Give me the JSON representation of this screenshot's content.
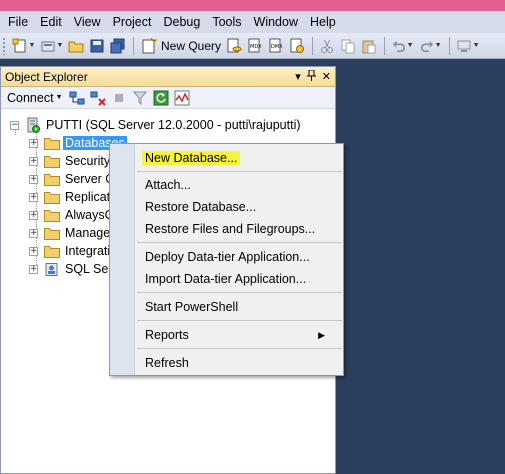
{
  "menubar": {
    "items": [
      "File",
      "Edit",
      "View",
      "Project",
      "Debug",
      "Tools",
      "Window",
      "Help"
    ]
  },
  "toolbar": {
    "new_query_label": "New Query",
    "icons": [
      "new-project-icon",
      "add-item-icon",
      "open-file-icon",
      "save-icon",
      "save-all-icon",
      "new-query-icon",
      "database-engine-query-icon",
      "analysis-services-mdx-icon",
      "dmx-query-icon",
      "xmla-query-icon",
      "cut-icon",
      "copy-icon",
      "paste-icon",
      "undo-icon",
      "redo-icon",
      "navigate-icon"
    ]
  },
  "object_explorer": {
    "title": "Object Explorer",
    "connect_label": "Connect",
    "server_node": "PUTTI (SQL Server 12.0.2000 - putti\\rajuputti)",
    "nodes": [
      "Databases",
      "Security",
      "Server O",
      "Replicati",
      "AlwaysO",
      "Manage",
      "Integrati",
      "SQL Serv"
    ],
    "selected_node": "Databases"
  },
  "context_menu": {
    "items": [
      "New Database...",
      "Attach...",
      "Restore Database...",
      "Restore Files and Filegroups...",
      "Deploy Data-tier Application...",
      "Import Data-tier Application...",
      "Start PowerShell",
      "Reports",
      "Refresh"
    ],
    "highlighted_item": "New Database...",
    "highlight_color": "#f7f23c"
  },
  "colors": {
    "title_strip": "#e2608f",
    "document_background": "#2c3e5e",
    "selection": "#3399ff"
  }
}
